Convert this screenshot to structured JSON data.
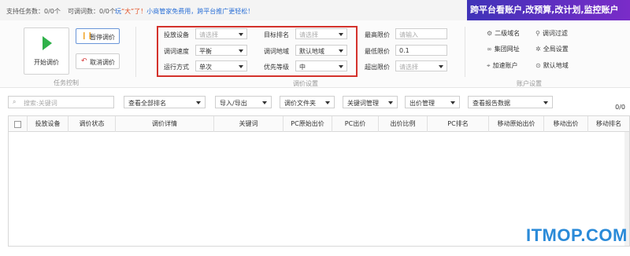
{
  "status": {
    "supported_tasks": "支持任务数：0/0个",
    "adjustable_words": "可调词数：0/0个",
    "promo_prefix": "玩",
    "promo_highlight": "“大”了！",
    "promo_text": "小商管家免费用，跨平台推广更轻松！",
    "banner": "跨平台看账户,改预算,改计划,监控账户"
  },
  "task_control": {
    "start_label": "开始调价",
    "pause_label": "暂停调价",
    "cancel_label": "取消调价",
    "group_label": "任务控制"
  },
  "price_settings": {
    "group_label": "调价设置",
    "fields": {
      "device": {
        "label": "投放设备",
        "value": "请选择"
      },
      "target_rank": {
        "label": "目标排名",
        "value": "请选择"
      },
      "speed": {
        "label": "调词速度",
        "value": "平衡"
      },
      "region": {
        "label": "调词地域",
        "value": "默认地域"
      },
      "mode": {
        "label": "运行方式",
        "value": "单次"
      },
      "priority": {
        "label": "优先等级",
        "value": "中"
      },
      "max_price": {
        "label": "最高限价",
        "placeholder": "请输入"
      },
      "min_price": {
        "label": "最低限价",
        "value": "0.1"
      },
      "over_limit": {
        "label": "超出限价",
        "value": "请选择"
      }
    }
  },
  "account_settings": {
    "group_label": "账户设置",
    "items": {
      "second_domain": "二级域名",
      "word_filter": "调词过滤",
      "group_url": "集团网址",
      "global_settings": "全局设置",
      "speed_account": "加速账户",
      "default_region": "默认地域"
    }
  },
  "filters": {
    "search_placeholder": "搜索:关键词",
    "rank_view": "查看全部排名",
    "import_export": "导入/导出",
    "price_folder": "调价文件夹",
    "keyword_mgmt": "关键词管理",
    "bid_mgmt": "出价管理",
    "report_data": "查看报告数据",
    "count": "0/0"
  },
  "table": {
    "columns": [
      "投放设备",
      "调价状态",
      "调价详情",
      "关键词",
      "PC原始出价",
      "PC出价",
      "出价比例",
      "PC排名",
      "移动原始出价",
      "移动出价",
      "移动排名"
    ]
  },
  "watermark": "ITMOP.COM",
  "colors": {
    "highlight_border": "#d4322c",
    "start_icon": "#2fb14a",
    "banner_start": "#3f33b8",
    "banner_end": "#7a2cc8",
    "link_blue": "#2a6fd6"
  }
}
